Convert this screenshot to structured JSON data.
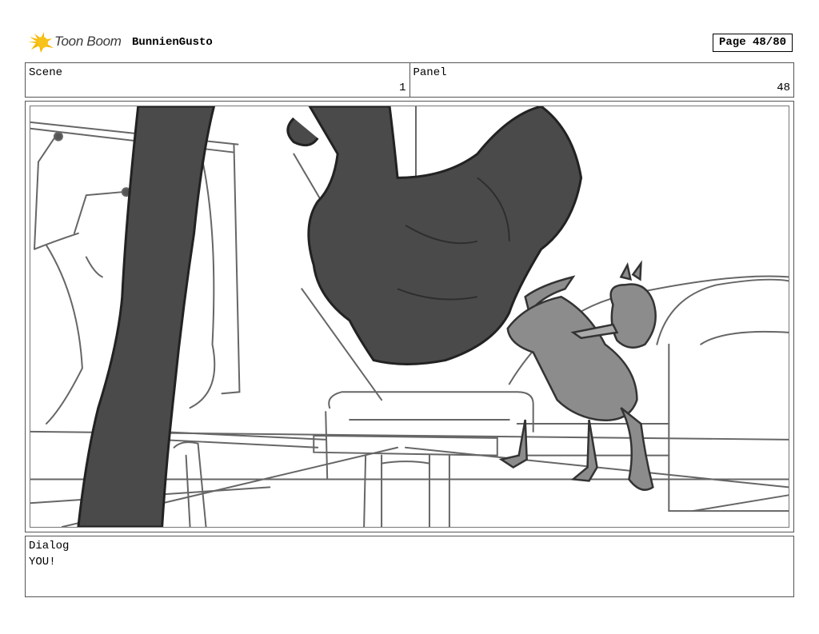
{
  "header": {
    "brand": "Toon Boom",
    "project": "BunnienGusto",
    "page": "Page 48/80"
  },
  "info": {
    "scene_label": "Scene",
    "scene_value": "1",
    "panel_label": "Panel",
    "panel_value": "48"
  },
  "dialog": {
    "label": "Dialog",
    "text": "YOU!"
  },
  "colors": {
    "logo_yellow": "#f5b800",
    "dark_shape": "#4a4a4a",
    "duck_grey": "#8c8c8c",
    "line": "#555555"
  }
}
